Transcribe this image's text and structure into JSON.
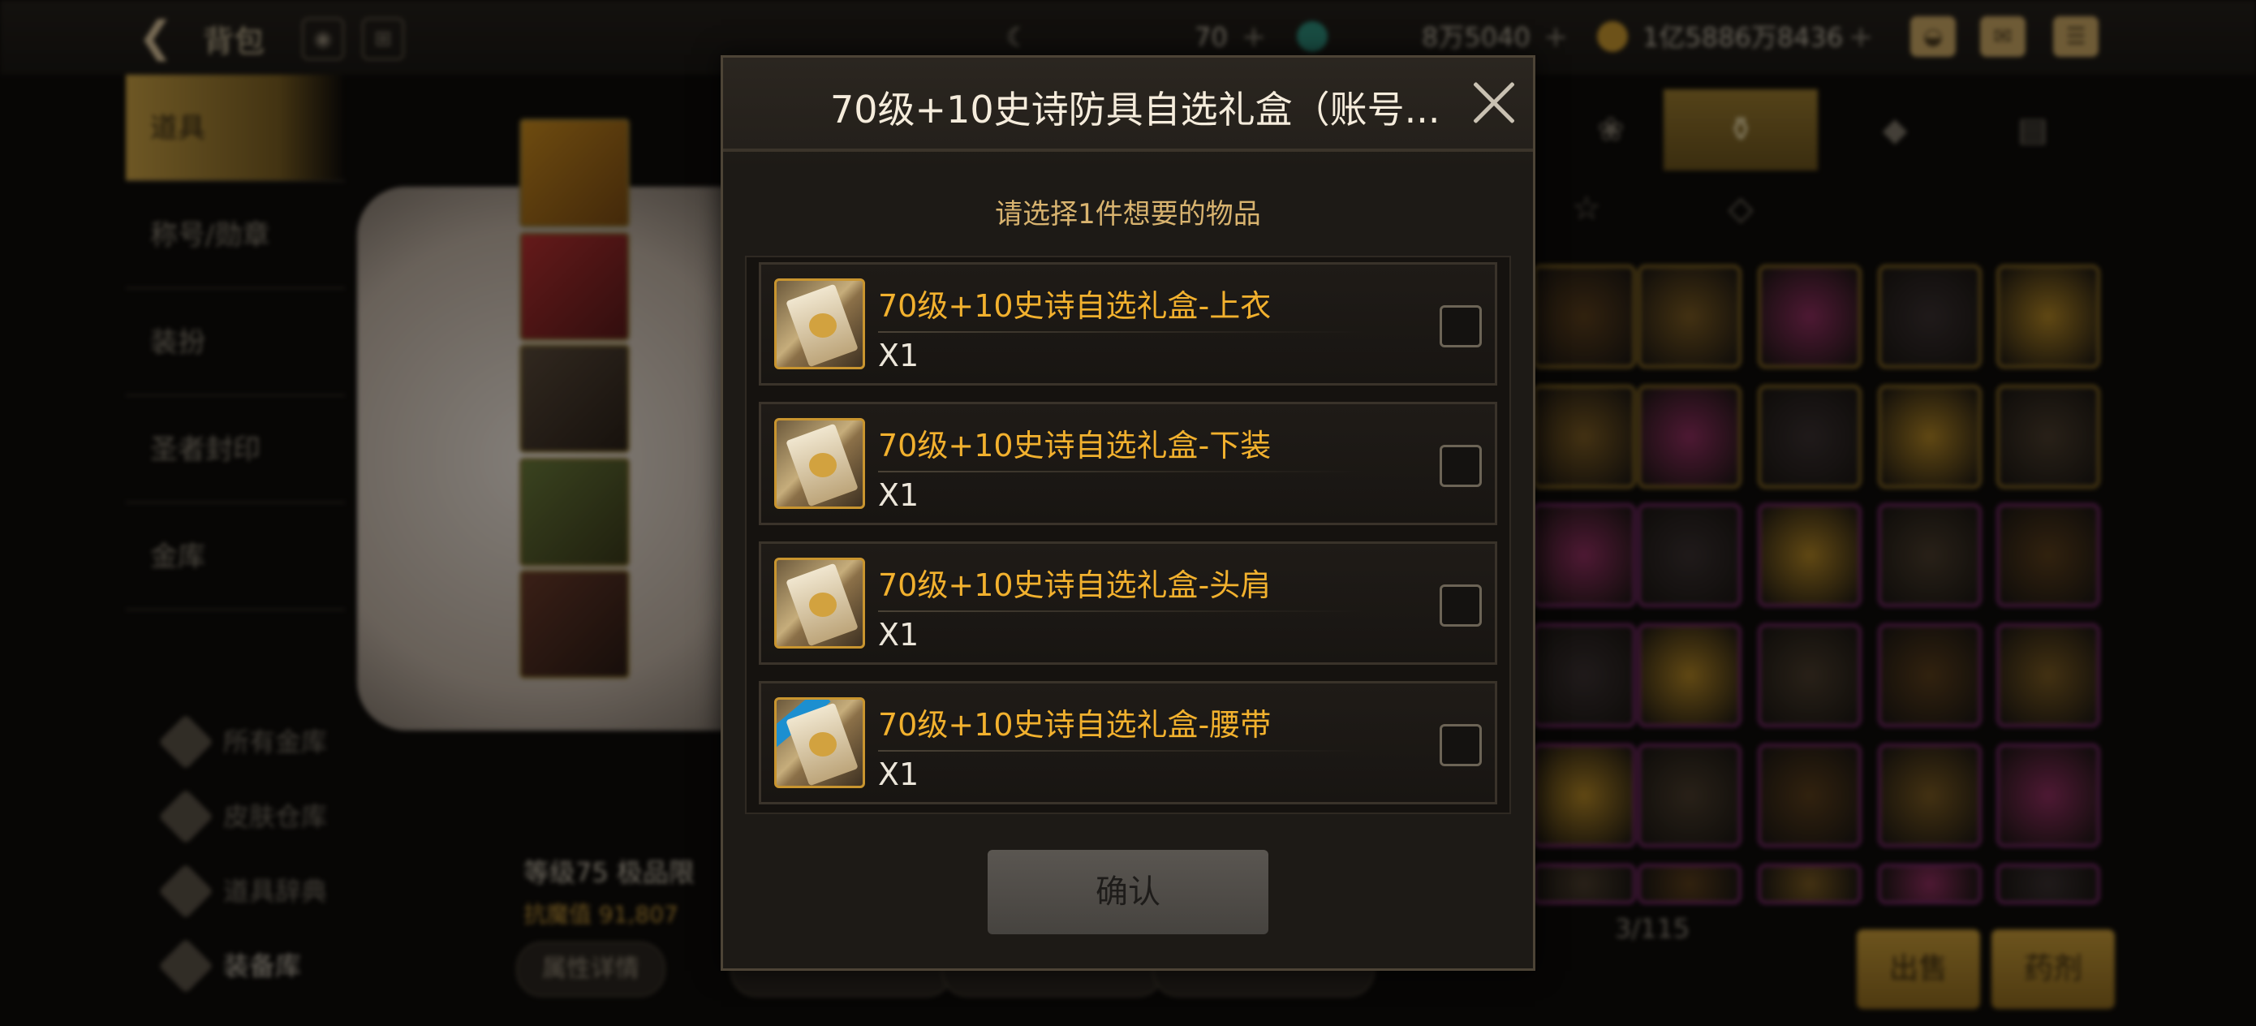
{
  "topbar": {
    "back_icon": "back-arrow-icon",
    "title": "背包",
    "energy_value": "70",
    "gem_value": "8万5040",
    "gold_value": "1亿5886万8436"
  },
  "sidebar": {
    "items": [
      {
        "label": "道具"
      },
      {
        "label": "称号/勋章"
      },
      {
        "label": "装扮"
      },
      {
        "label": "圣者封印"
      },
      {
        "label": "金库"
      }
    ],
    "bottom": [
      {
        "label": "所有金库"
      },
      {
        "label": "皮肤仓库"
      },
      {
        "label": "道具辞典"
      },
      {
        "label": "装备库"
      }
    ]
  },
  "character": {
    "info_line": "等级75 极品限",
    "stat_line": "抗魔值 91,807",
    "buttons": [
      "属性详情"
    ]
  },
  "inventory": {
    "count": "3/115",
    "sell_label": "出售",
    "craft_label": "药剂"
  },
  "modal": {
    "title": "70级+10史诗防具自选礼盒（账号...",
    "subtitle": "请选择1件想要的物品",
    "items": [
      {
        "name": "70级+10史诗自选礼盒-上衣",
        "qty": "X1"
      },
      {
        "name": "70级+10史诗自选礼盒-下装",
        "qty": "X1"
      },
      {
        "name": "70级+10史诗自选礼盒-头肩",
        "qty": "X1"
      },
      {
        "name": "70级+10史诗自选礼盒-腰带",
        "qty": "X1"
      }
    ],
    "confirm_label": "确认"
  },
  "colors": {
    "accent_gold": "#f2b12e",
    "subtitle": "#d8b36f",
    "modal_bg": "#1d1a16"
  }
}
